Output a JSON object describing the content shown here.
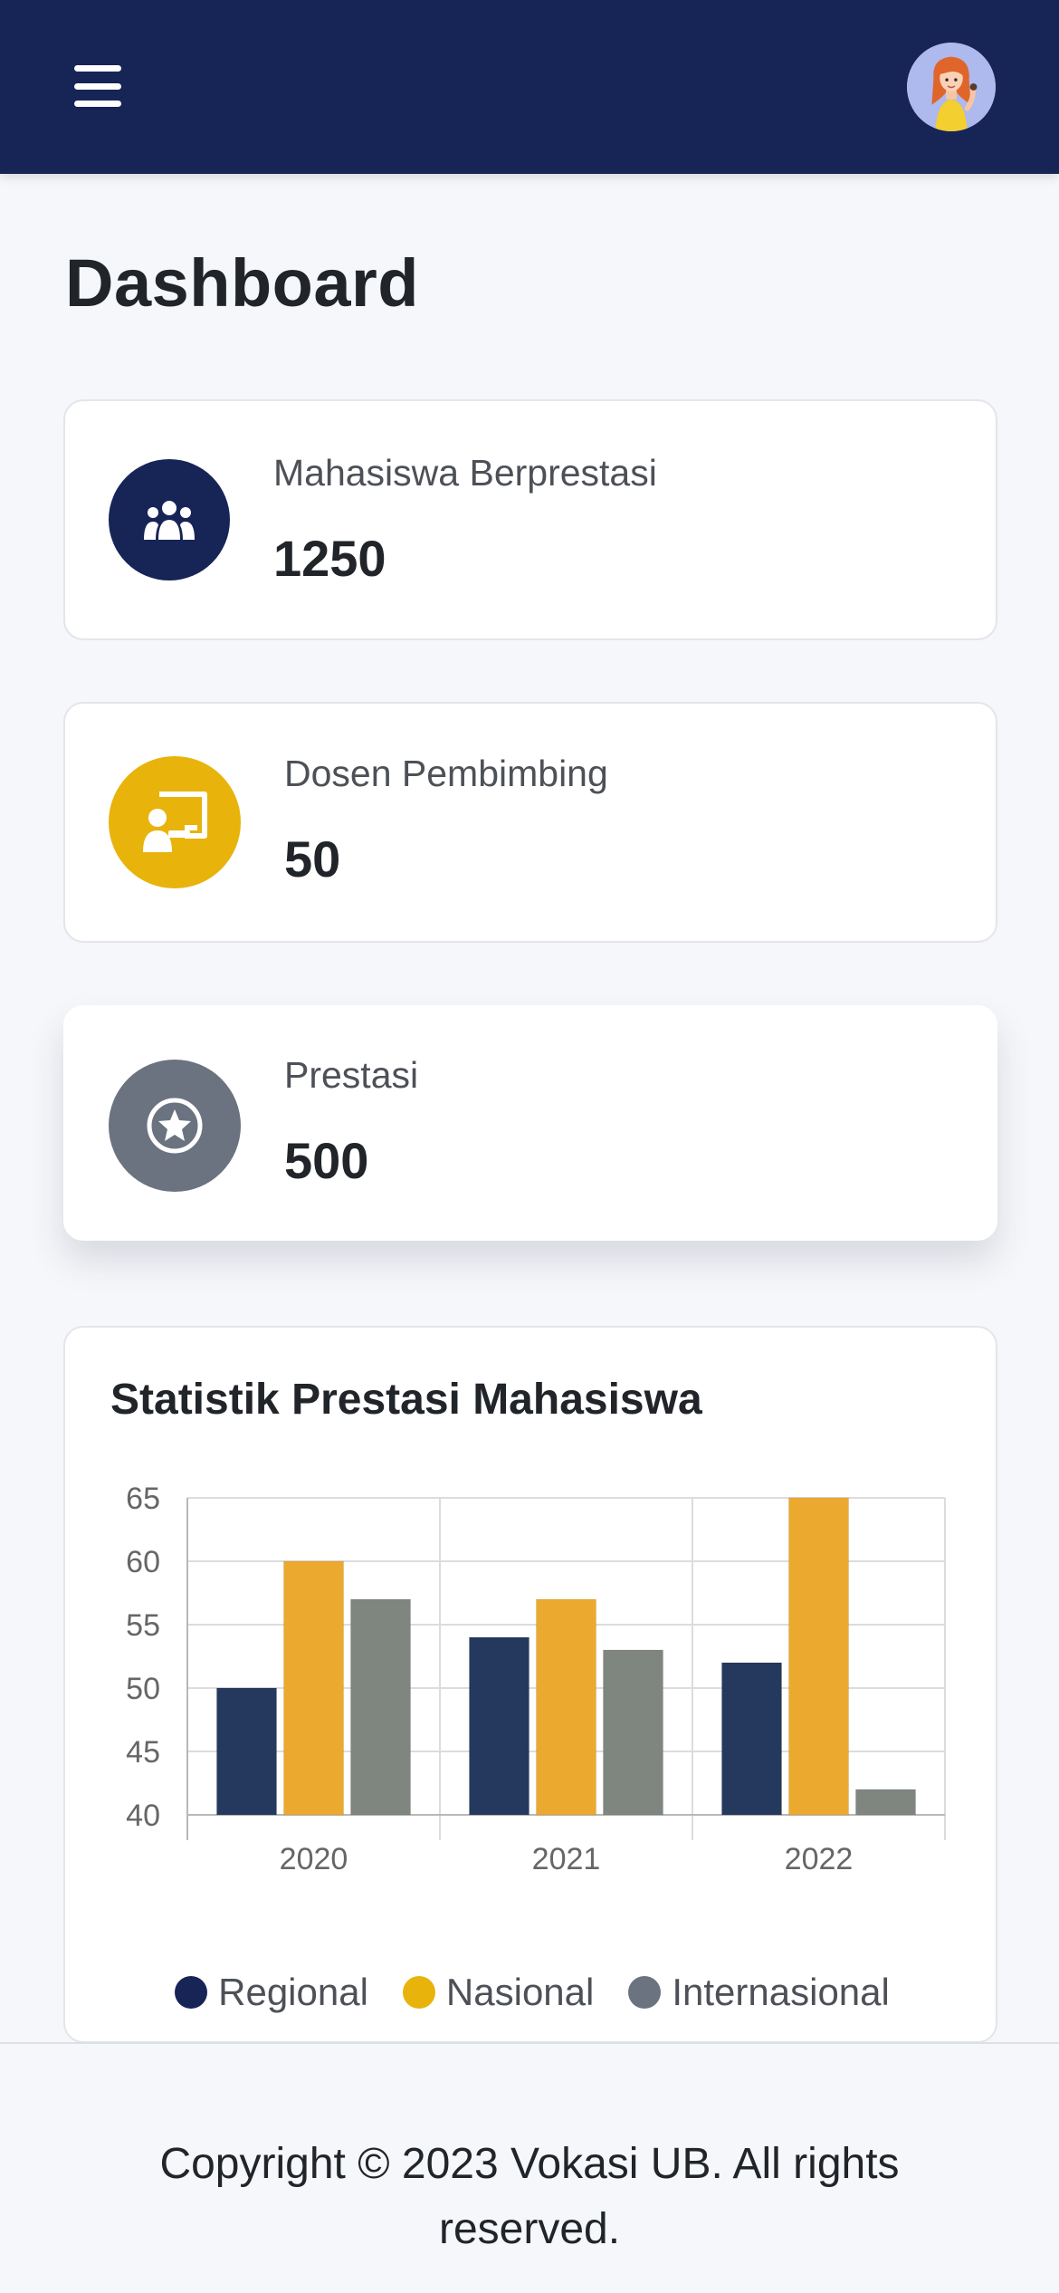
{
  "header": {
    "menu_icon": "hamburger-menu-icon",
    "avatar_icon": "user-avatar",
    "colors": {
      "background": "#172456"
    }
  },
  "page": {
    "title": "Dashboard"
  },
  "stats": [
    {
      "label": "Mahasiswa Berprestasi",
      "value": "1250",
      "icon": "users-group-icon",
      "color": "#172456"
    },
    {
      "label": "Dosen Pembimbing",
      "value": "50",
      "icon": "teacher-board-icon",
      "color": "#e8b30b"
    },
    {
      "label": "Prestasi",
      "value": "500",
      "icon": "star-circle-icon",
      "color": "#6b7280"
    }
  ],
  "chart": {
    "title": "Statistik Prestasi Mahasiswa",
    "legend": [
      {
        "label": "Regional",
        "color": "#172456"
      },
      {
        "label": "Nasional",
        "color": "#e8b30b"
      },
      {
        "label": "Internasional",
        "color": "#6b7280"
      }
    ]
  },
  "chart_data": {
    "type": "bar",
    "title": "Statistik Prestasi Mahasiswa",
    "categories": [
      "2020",
      "2021",
      "2022"
    ],
    "series": [
      {
        "name": "Regional",
        "values": [
          50,
          54,
          52
        ],
        "color": "#25395e"
      },
      {
        "name": "Nasional",
        "values": [
          60,
          57,
          65
        ],
        "color": "#ebaa2f"
      },
      {
        "name": "Internasional",
        "values": [
          57,
          53,
          42
        ],
        "color": "#7f857f"
      }
    ],
    "ylim": [
      40,
      65
    ],
    "yticks": [
      "40",
      "45",
      "50",
      "55",
      "60",
      "65"
    ],
    "grid": true,
    "legend_position": "bottom"
  },
  "footer": {
    "copyright": "Copyright © 2023 Vokasi UB. All rights reserved."
  }
}
